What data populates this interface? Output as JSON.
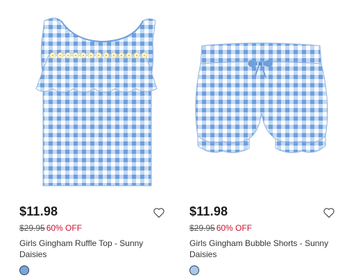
{
  "products": [
    {
      "price": "$11.98",
      "original_price": "$29.95",
      "discount": "60% OFF",
      "title": "Girls Gingham Ruffle Top - Sunny Daisies",
      "swatch_color": "#7aa6d8",
      "icon": "heart-outline-icon"
    },
    {
      "price": "$11.98",
      "original_price": "$29.95",
      "discount": "60% OFF",
      "title": "Girls Gingham Bubble Shorts - Sunny Daisies",
      "swatch_color": "#a9c9ec",
      "icon": "heart-outline-icon"
    }
  ],
  "colors": {
    "gingham_light": "#b9d3f1",
    "gingham_dark": "#6f9fdc",
    "sale_red": "#c8102e"
  }
}
